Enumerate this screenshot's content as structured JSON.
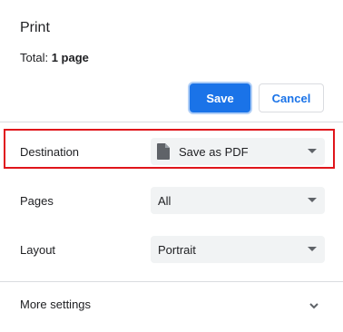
{
  "dialog": {
    "title": "Print",
    "total_label": "Total:",
    "total_value": "1 page"
  },
  "actions": {
    "save_label": "Save",
    "cancel_label": "Cancel"
  },
  "settings": {
    "destination": {
      "label": "Destination",
      "value": "Save as PDF",
      "icon": "file-icon"
    },
    "pages": {
      "label": "Pages",
      "value": "All"
    },
    "layout": {
      "label": "Layout",
      "value": "Portrait"
    }
  },
  "more_settings": {
    "label": "More settings",
    "icon": "chevron-down-icon"
  },
  "colors": {
    "accent": "#1a73e8",
    "highlight": "#e0151b",
    "select_bg": "#f1f3f4"
  }
}
